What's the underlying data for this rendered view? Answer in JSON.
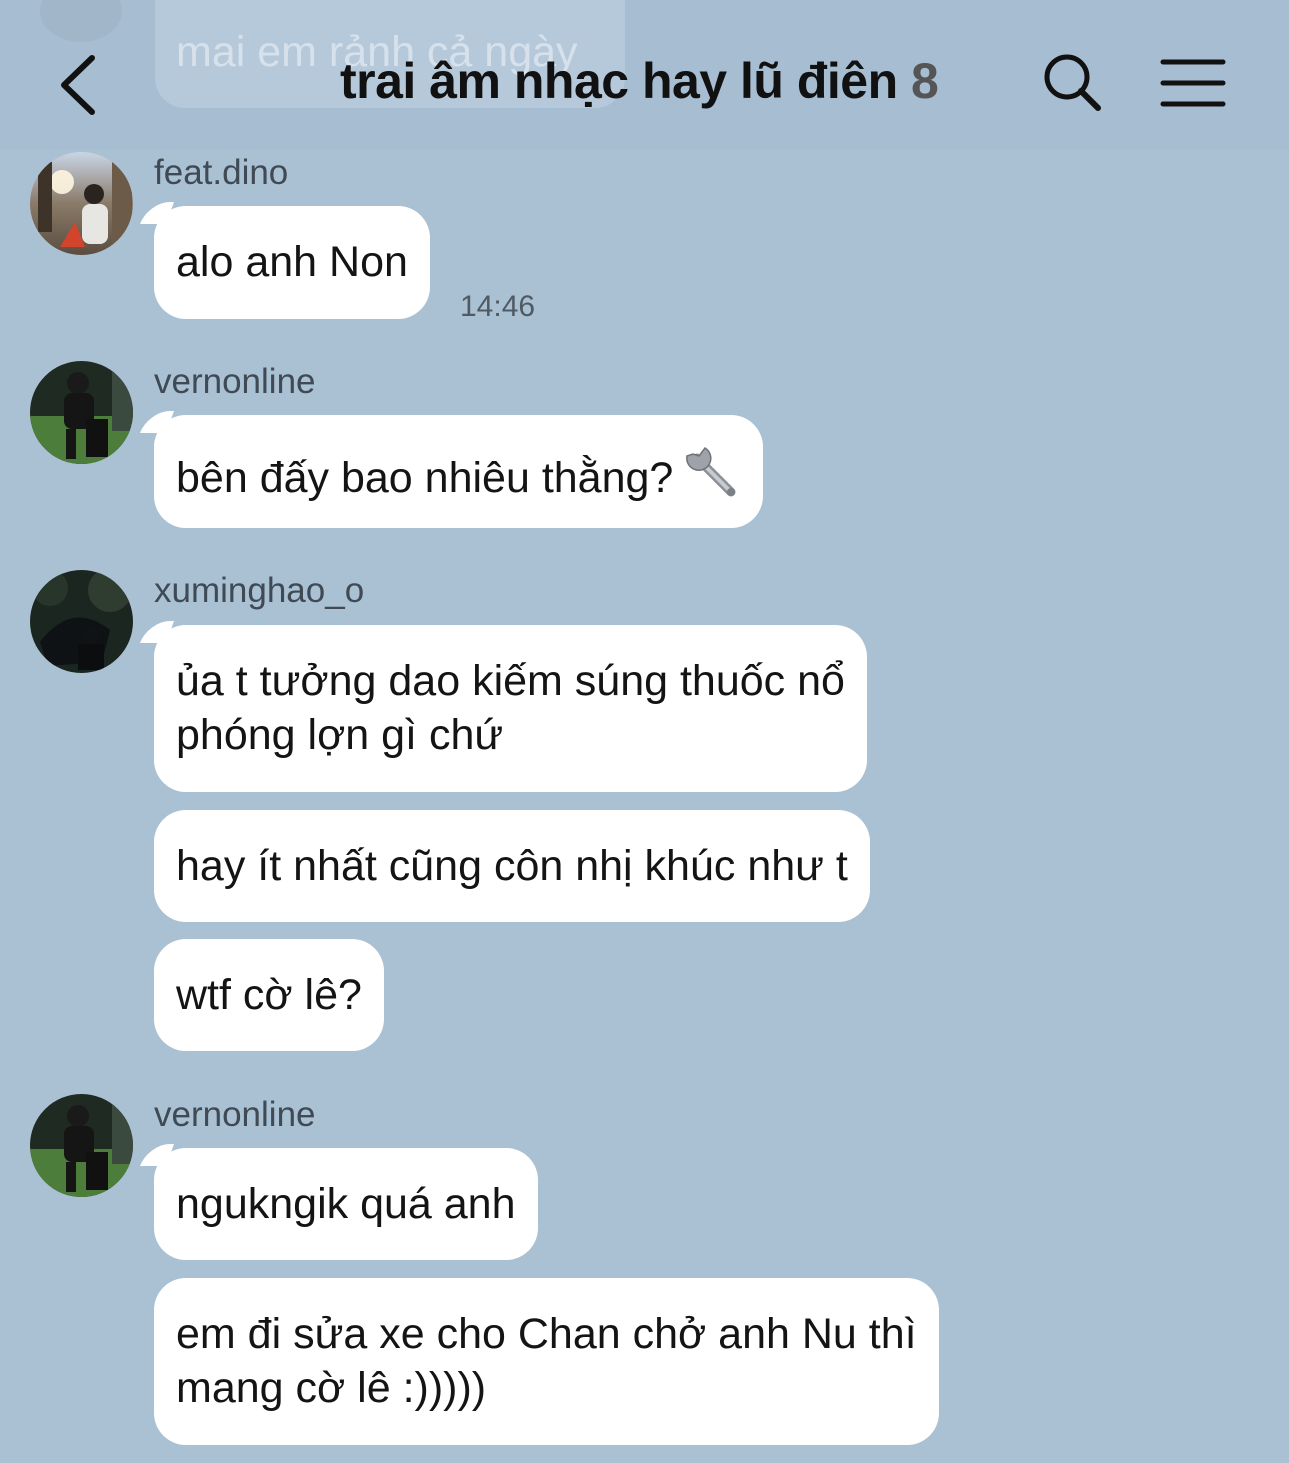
{
  "header": {
    "previous_message_preview": "mai em rảnh cả ngày",
    "title": "trai âm nhạc hay lũ điên",
    "member_count": "8"
  },
  "messages": [
    {
      "sender": "feat.dino",
      "text": "alo anh Non",
      "time": "14:46"
    },
    {
      "sender": "vernonline",
      "text": "bên đấy bao nhiêu thằng?",
      "emoji": "wrench-emoji"
    },
    {
      "sender": "xuminghao_o",
      "lines": [
        "ủa t tưởng dao kiếm súng thuốc nổ",
        "phóng lợn gì chứ"
      ]
    },
    {
      "text": "hay ít nhất cũng côn nhị khúc như t"
    },
    {
      "text": "wtf cờ lê?"
    },
    {
      "sender": "vernonline",
      "text": "ngukngik quá anh"
    },
    {
      "lines": [
        "em đi sửa xe cho Chan chở anh Nu thì",
        "mang cờ lê :)))))"
      ]
    }
  ]
}
